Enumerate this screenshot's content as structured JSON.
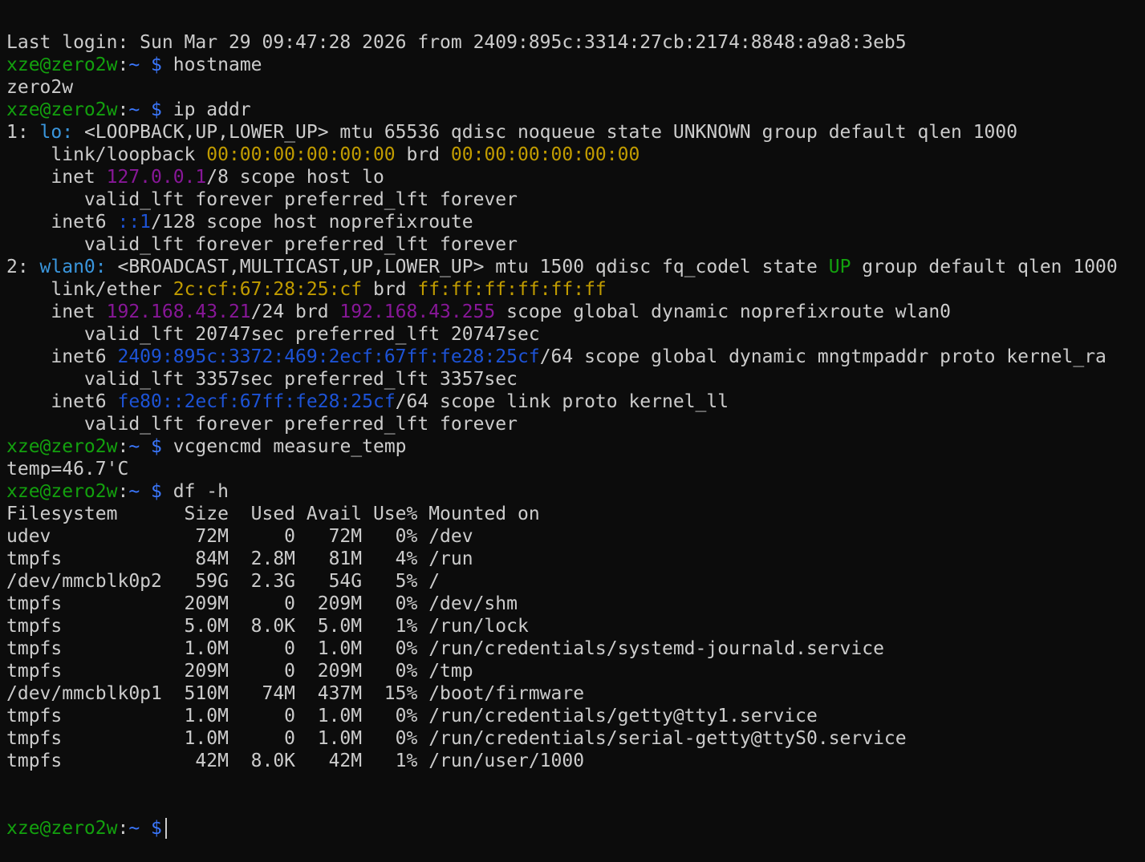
{
  "colors": {
    "background": "#0c0c0c",
    "foreground": "#cccccc",
    "prompt_user": "#13a10e",
    "prompt_path": "#3b78ff",
    "interface_name": "#3a96dd",
    "mac_address": "#c19c00",
    "ipv4_address": "#881798",
    "ipv6_address": "#1d53d6",
    "state_up": "#13a10e"
  },
  "lines": [
    [
      {
        "t": "Last login: Sun Mar 29 09:47:28 2026 from 2409:895c:3314:27cb:2174:8848:a9a8:3eb5"
      }
    ],
    [
      {
        "t": "xze@zero2w",
        "c": "user"
      },
      {
        "t": ":"
      },
      {
        "t": "~ $",
        "c": "path"
      },
      {
        "t": " hostname"
      }
    ],
    [
      {
        "t": "zero2w"
      }
    ],
    [
      {
        "t": "xze@zero2w",
        "c": "user"
      },
      {
        "t": ":"
      },
      {
        "t": "~ $",
        "c": "path"
      },
      {
        "t": " ip addr"
      }
    ],
    [
      {
        "t": "1: "
      },
      {
        "t": "lo:",
        "c": "iface"
      },
      {
        "t": " <LOOPBACK,UP,LOWER_UP> mtu 65536 qdisc noqueue state UNKNOWN group default qlen 1000"
      }
    ],
    [
      {
        "t": "    link/loopback "
      },
      {
        "t": "00:00:00:00:00:00",
        "c": "mac"
      },
      {
        "t": " brd "
      },
      {
        "t": "00:00:00:00:00:00",
        "c": "mac"
      }
    ],
    [
      {
        "t": "    inet "
      },
      {
        "t": "127.0.0.1",
        "c": "ipv4"
      },
      {
        "t": "/8 scope host lo"
      }
    ],
    [
      {
        "t": "       valid_lft forever preferred_lft forever"
      }
    ],
    [
      {
        "t": "    inet6 "
      },
      {
        "t": "::1",
        "c": "ipv6"
      },
      {
        "t": "/128 scope host noprefixroute"
      }
    ],
    [
      {
        "t": "       valid_lft forever preferred_lft forever"
      }
    ],
    [
      {
        "t": "2: "
      },
      {
        "t": "wlan0:",
        "c": "iface"
      },
      {
        "t": " <BROADCAST,MULTICAST,UP,LOWER_UP> mtu 1500 qdisc fq_codel state "
      },
      {
        "t": "UP",
        "c": "up"
      },
      {
        "t": " group default qlen 1000"
      }
    ],
    [
      {
        "t": "    link/ether "
      },
      {
        "t": "2c:cf:67:28:25:cf",
        "c": "mac"
      },
      {
        "t": " brd "
      },
      {
        "t": "ff:ff:ff:ff:ff:ff",
        "c": "mac"
      }
    ],
    [
      {
        "t": "    inet "
      },
      {
        "t": "192.168.43.21",
        "c": "ipv4"
      },
      {
        "t": "/24 brd "
      },
      {
        "t": "192.168.43.255",
        "c": "ipv4"
      },
      {
        "t": " scope global dynamic noprefixroute wlan0"
      }
    ],
    [
      {
        "t": "       valid_lft 20747sec preferred_lft 20747sec"
      }
    ],
    [
      {
        "t": "    inet6 "
      },
      {
        "t": "2409:895c:3372:469:2ecf:67ff:fe28:25cf",
        "c": "ipv6"
      },
      {
        "t": "/64 scope global dynamic mngtmpaddr proto kernel_ra"
      }
    ],
    [
      {
        "t": "       valid_lft 3357sec preferred_lft 3357sec"
      }
    ],
    [
      {
        "t": "    inet6 "
      },
      {
        "t": "fe80::2ecf:67ff:fe28:25cf",
        "c": "ipv6"
      },
      {
        "t": "/64 scope link proto kernel_ll"
      }
    ],
    [
      {
        "t": "       valid_lft forever preferred_lft forever"
      }
    ],
    [
      {
        "t": "xze@zero2w",
        "c": "user"
      },
      {
        "t": ":"
      },
      {
        "t": "~ $",
        "c": "path"
      },
      {
        "t": " vcgencmd measure_temp"
      }
    ],
    [
      {
        "t": "temp=46.7'C"
      }
    ],
    [
      {
        "t": "xze@zero2w",
        "c": "user"
      },
      {
        "t": ":"
      },
      {
        "t": "~ $",
        "c": "path"
      },
      {
        "t": " df -h"
      }
    ],
    [
      {
        "t": "Filesystem      Size  Used Avail Use% Mounted on"
      }
    ],
    [
      {
        "t": "udev             72M     0   72M   0% /dev"
      }
    ],
    [
      {
        "t": "tmpfs            84M  2.8M   81M   4% /run"
      }
    ],
    [
      {
        "t": "/dev/mmcblk0p2   59G  2.3G   54G   5% /"
      }
    ],
    [
      {
        "t": "tmpfs           209M     0  209M   0% /dev/shm"
      }
    ],
    [
      {
        "t": "tmpfs           5.0M  8.0K  5.0M   1% /run/lock"
      }
    ],
    [
      {
        "t": "tmpfs           1.0M     0  1.0M   0% /run/credentials/systemd-journald.service"
      }
    ],
    [
      {
        "t": "tmpfs           209M     0  209M   0% /tmp"
      }
    ],
    [
      {
        "t": "/dev/mmcblk0p1  510M   74M  437M  15% /boot/firmware"
      }
    ],
    [
      {
        "t": "tmpfs           1.0M     0  1.0M   0% /run/credentials/getty@tty1.service"
      }
    ],
    [
      {
        "t": "tmpfs           1.0M     0  1.0M   0% /run/credentials/serial-getty@ttyS0.service"
      }
    ],
    [
      {
        "t": "tmpfs            42M  8.0K   42M   1% /run/user/1000"
      }
    ]
  ],
  "prompt": {
    "user_host": "xze@zero2w",
    "separator": ":",
    "path_symbol": "~ $",
    "input": ""
  }
}
